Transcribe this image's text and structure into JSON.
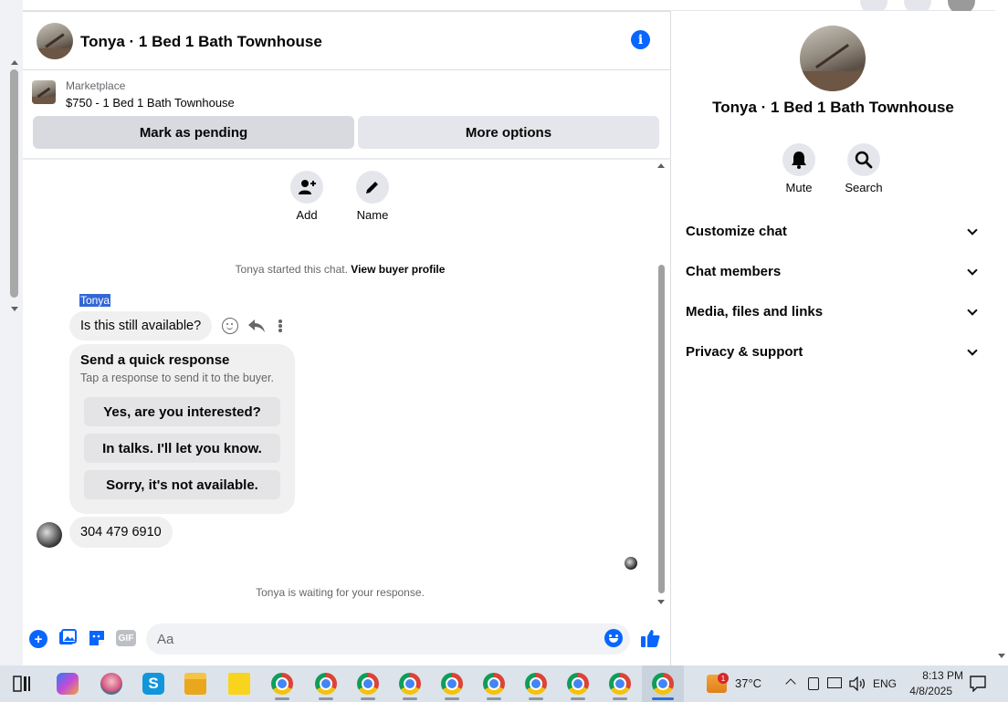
{
  "header": {
    "title": "Tonya · 1 Bed 1 Bath Townhouse",
    "info_icon": "info-icon"
  },
  "listing": {
    "source": "Marketplace",
    "price_title": "$750 - 1 Bed 1 Bath Townhouse",
    "mark_pending_label": "Mark as pending",
    "more_options_label": "More options"
  },
  "chat_actions": {
    "add_label": "Add",
    "name_label": "Name"
  },
  "messages": {
    "started_text": "Tonya started this chat.",
    "buyer_profile_link": "View buyer profile",
    "sender_name": "Tonya",
    "first_message": "Is this still available?",
    "quick_response_title": "Send a quick response",
    "quick_response_subtitle": "Tap a response to send it to the buyer.",
    "quick_responses": [
      "Yes, are you interested?",
      "In talks. I'll let you know.",
      "Sorry, it's not available."
    ],
    "second_message": "304 479 6910",
    "waiting_text": "Tonya is waiting for your response."
  },
  "composer": {
    "placeholder": "Aa",
    "gif_label": "GIF"
  },
  "right_panel": {
    "title": "Tonya · 1 Bed 1 Bath Townhouse",
    "mute_label": "Mute",
    "search_label": "Search",
    "sections": [
      "Customize chat",
      "Chat members",
      "Media, files and links",
      "Privacy & support"
    ]
  },
  "taskbar": {
    "weather_badge": "1",
    "temperature": "37°C",
    "language": "ENG",
    "time": "8:13 PM",
    "date": "4/8/2025"
  },
  "colors": {
    "accent": "#0866ff",
    "bubble": "#f0f0f0",
    "button_grey": "#e4e6eb",
    "taskbar": "#dde3ea"
  }
}
